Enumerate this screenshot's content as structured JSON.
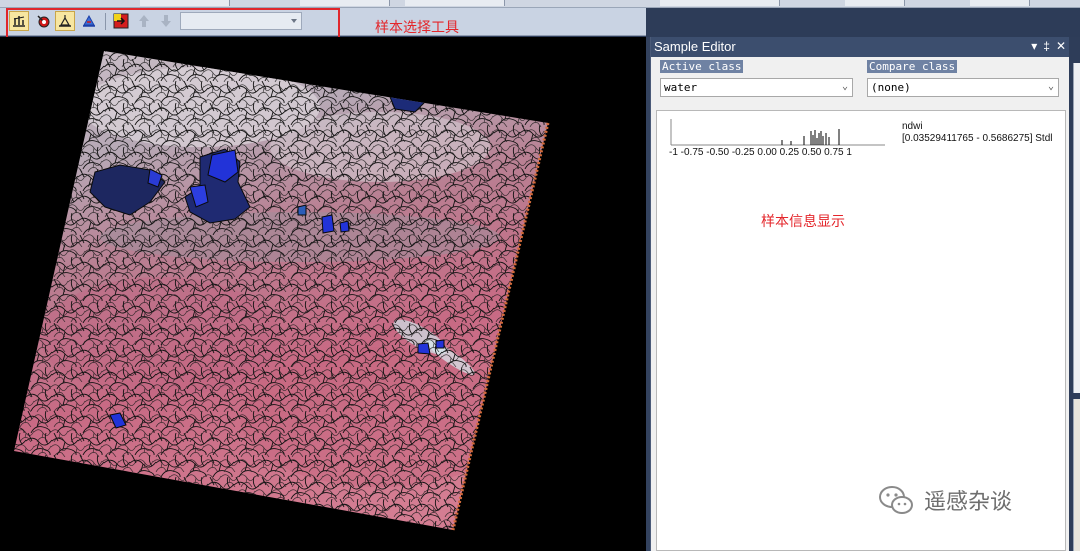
{
  "toolbar": {
    "annotation": "样本选择工具",
    "buttons": [
      {
        "icon": "select-samples-icon"
      },
      {
        "icon": "sample-feature-icon"
      },
      {
        "icon": "select-samples-from-tta-icon"
      },
      {
        "icon": "sample-selection-icon"
      },
      {
        "icon": "navigate-samples-icon"
      },
      {
        "icon": "arrow-up-icon"
      },
      {
        "icon": "arrow-down-icon"
      }
    ],
    "combo_value": ""
  },
  "sample_editor": {
    "title": "Sample Editor",
    "controls": [
      "▾",
      "‡",
      "✕"
    ],
    "active_class_label": "Active class",
    "active_class_value": "water",
    "compare_class_label": "Compare class",
    "compare_class_value": "(none)",
    "histogram": {
      "feature": "ndwi",
      "range_text": "[0.03529411765 - 0.5686275] Stdl",
      "tick_labels": "-1   -0.75 -0.50 -0.25 0.00  0.25  0.50  0.75   1"
    },
    "info_annotation": "样本信息显示"
  },
  "watermark": {
    "text": "遥感杂谈"
  },
  "colors": {
    "annotation_red": "#e4262b",
    "panel_title_bg": "#3c4e6e",
    "class_label_bg": "#6f82a3",
    "water_sample_blue": "#1e2fd0"
  }
}
